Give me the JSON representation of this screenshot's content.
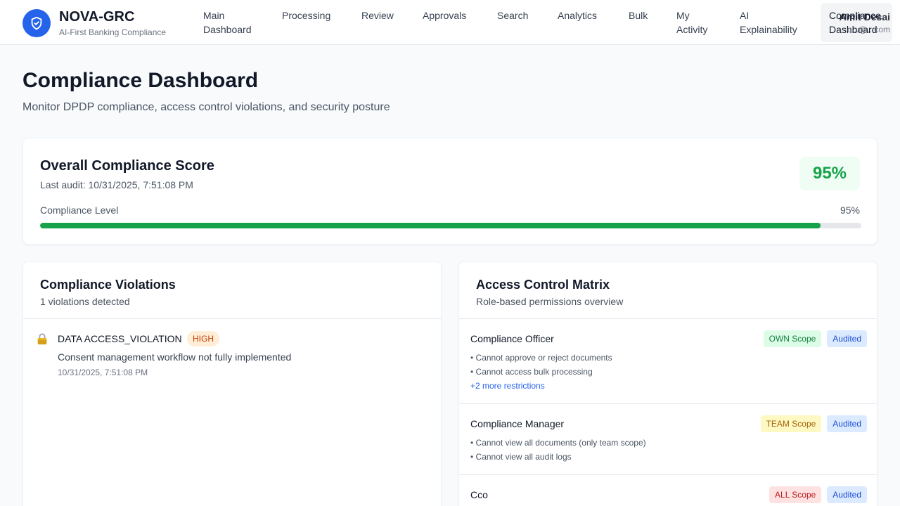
{
  "app": {
    "name": "NOVA-GRC",
    "tagline": "AI-First Banking Compliance",
    "logo_icon": "shield-check-icon",
    "accent": "#2563eb"
  },
  "nav": {
    "items": [
      {
        "line1": "Main",
        "line2": "Dashboard"
      },
      {
        "line1": "Processing",
        "line2": ""
      },
      {
        "line1": "Review",
        "line2": ""
      },
      {
        "line1": "Approvals",
        "line2": ""
      },
      {
        "line1": "Search",
        "line2": ""
      },
      {
        "line1": "Analytics",
        "line2": ""
      },
      {
        "line1": "Bulk",
        "line2": ""
      },
      {
        "line1": "My",
        "line2": "Activity"
      },
      {
        "line1": "AI",
        "line2": "Explainability"
      },
      {
        "line1": "Compliance",
        "line2": "Dashboard"
      }
    ],
    "active_index": 9
  },
  "user": {
    "name": "Amit Desai",
    "email": "c...@...com"
  },
  "page": {
    "title": "Compliance Dashboard",
    "subtitle": "Monitor DPDP compliance, access control violations, and security posture"
  },
  "score": {
    "title": "Overall Compliance Score",
    "last_audit": "Last audit: 10/31/2025, 7:51:08 PM",
    "badge": "95%",
    "level_label": "Compliance Level",
    "level_value": "95%",
    "fraction": 0.95,
    "color": "#16a34a"
  },
  "violations": {
    "title": "Compliance Violations",
    "count_text": "1 violations detected",
    "items": [
      {
        "icon": "lock-icon",
        "type": "DATA ACCESS_VIOLATION",
        "severity": "HIGH",
        "description": "Consent management workflow not fully implemented",
        "timestamp": "10/31/2025, 7:51:08 PM"
      }
    ]
  },
  "access": {
    "title": "Access Control Matrix",
    "subtitle": "Role-based permissions overview",
    "roles": [
      {
        "name": "Compliance Officer",
        "scope": "OWN Scope",
        "audited": "Audited",
        "restrictions": [
          "• Cannot approve or reject documents",
          "• Cannot access bulk processing"
        ],
        "more": "+2 more restrictions"
      },
      {
        "name": "Compliance Manager",
        "scope": "TEAM Scope",
        "audited": "Audited",
        "restrictions": [
          "• Cannot view all documents (only team scope)",
          "• Cannot view all audit logs"
        ],
        "more": ""
      },
      {
        "name": "Cco",
        "scope": "ALL Scope",
        "audited": "Audited",
        "restrictions": [],
        "more": ""
      }
    ]
  }
}
